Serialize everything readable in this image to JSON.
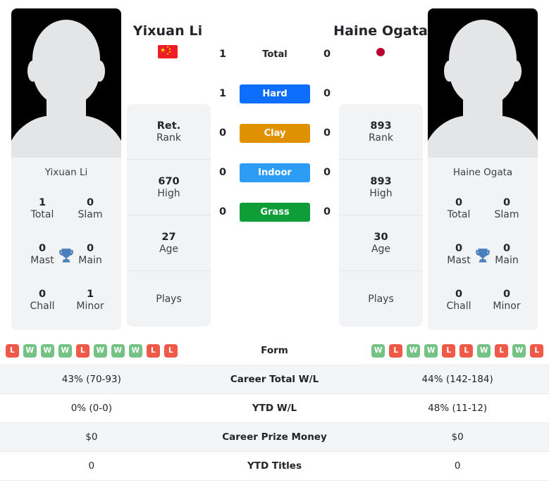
{
  "players": {
    "left": {
      "name": "Yixuan Li",
      "flag_icon": "flag-china-icon",
      "photo_caption": "Yixuan Li",
      "rank": "Ret.",
      "rank_label": "Rank",
      "high": "670",
      "high_label": "High",
      "age": "27",
      "age_label": "Age",
      "plays_label": "Plays",
      "plays_value": "",
      "titles": {
        "total": "1",
        "total_label": "Total",
        "slam": "0",
        "slam_label": "Slam",
        "mast": "0",
        "mast_label": "Mast",
        "main": "0",
        "main_label": "Main",
        "chall": "0",
        "chall_label": "Chall",
        "minor": "1",
        "minor_label": "Minor"
      },
      "form": [
        "L",
        "W",
        "W",
        "W",
        "L",
        "W",
        "W",
        "W",
        "L",
        "L"
      ],
      "career_wl": "43% (70-93)",
      "ytd_wl": "0% (0-0)",
      "career_prize": "$0",
      "ytd_titles": "0"
    },
    "right": {
      "name": "Haine Ogata",
      "flag_icon": "flag-japan-icon",
      "photo_caption": "Haine Ogata",
      "rank": "893",
      "rank_label": "Rank",
      "high": "893",
      "high_label": "High",
      "age": "30",
      "age_label": "Age",
      "plays_label": "Plays",
      "plays_value": "",
      "titles": {
        "total": "0",
        "total_label": "Total",
        "slam": "0",
        "slam_label": "Slam",
        "mast": "0",
        "mast_label": "Mast",
        "main": "0",
        "main_label": "Main",
        "chall": "0",
        "chall_label": "Chall",
        "minor": "0",
        "minor_label": "Minor"
      },
      "form": [
        "W",
        "L",
        "W",
        "W",
        "L",
        "L",
        "W",
        "L",
        "W",
        "L"
      ],
      "career_wl": "44% (142-184)",
      "ytd_wl": "48% (11-12)",
      "career_prize": "$0",
      "ytd_titles": "0"
    }
  },
  "head_to_head": [
    {
      "label": "Total",
      "left": "1",
      "right": "0",
      "style": "plain",
      "color": ""
    },
    {
      "label": "Hard",
      "left": "1",
      "right": "0",
      "style": "badge",
      "color": "#0d6efd"
    },
    {
      "label": "Clay",
      "left": "0",
      "right": "0",
      "style": "badge",
      "color": "#e09100"
    },
    {
      "label": "Indoor",
      "left": "0",
      "right": "0",
      "style": "badge",
      "color": "#2d9cf5"
    },
    {
      "label": "Grass",
      "left": "0",
      "right": "0",
      "style": "badge",
      "color": "#0f9d38"
    }
  ],
  "stats_rows": [
    {
      "label": "Form",
      "key": "form",
      "type": "form"
    },
    {
      "label": "Career Total W/L",
      "key": "career_wl",
      "type": "text"
    },
    {
      "label": "YTD W/L",
      "key": "ytd_wl",
      "type": "text"
    },
    {
      "label": "Career Prize Money",
      "key": "career_prize",
      "type": "text"
    },
    {
      "label": "YTD Titles",
      "key": "ytd_titles",
      "type": "text"
    }
  ],
  "colors": {
    "hard": "#0d6efd",
    "clay": "#e09100",
    "indoor": "#2d9cf5",
    "grass": "#0f9d38",
    "win": "#75c384",
    "loss": "#ef5a48",
    "card_bg": "#f1f3f4",
    "trophy": "#4a7ebb"
  }
}
